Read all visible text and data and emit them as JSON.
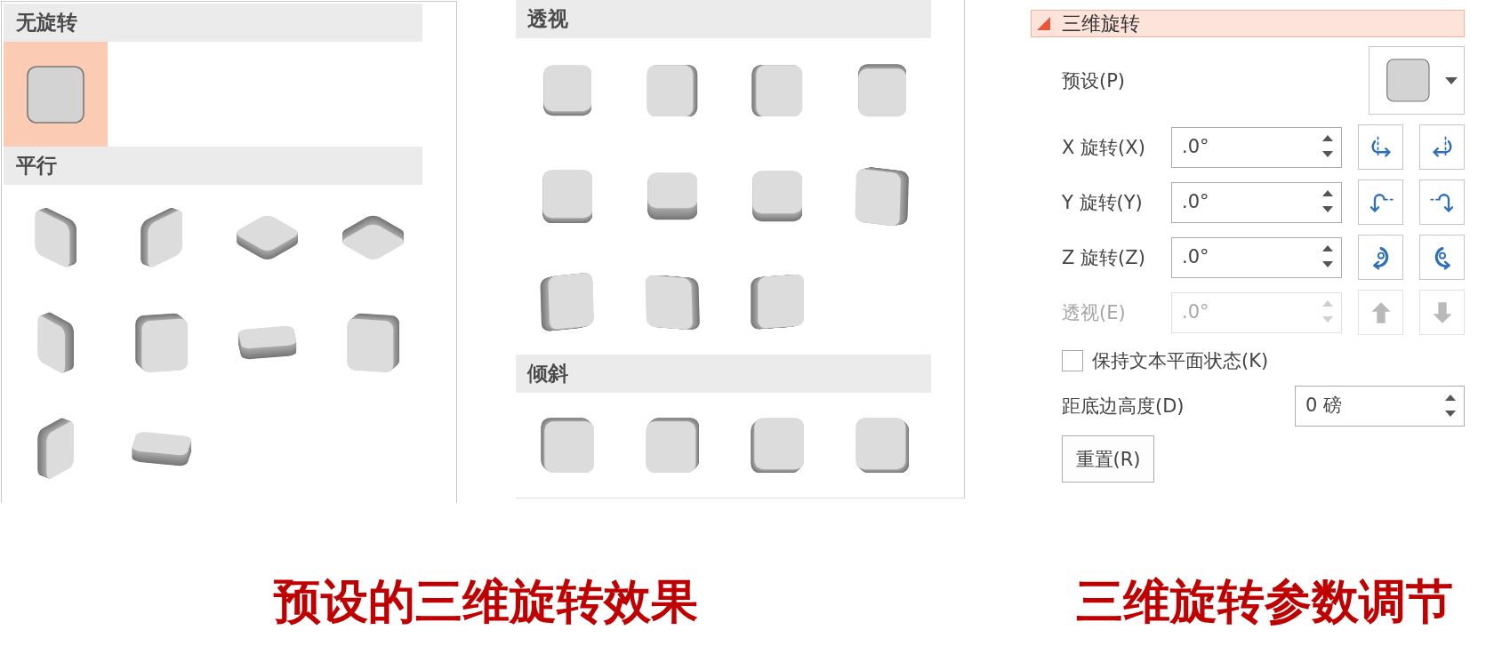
{
  "galleries": [
    {
      "sections": [
        {
          "title": "无旋转",
          "presets": [
            {
              "kind": "front",
              "selected": true
            }
          ]
        },
        {
          "title": "平行",
          "presets": [
            {
              "kind": "iso-right",
              "selected": false
            },
            {
              "kind": "iso-left",
              "selected": false
            },
            {
              "kind": "iso-top",
              "selected": false
            },
            {
              "kind": "iso-under",
              "selected": false
            },
            {
              "kind": "narrow-right",
              "selected": false
            },
            {
              "kind": "square-left",
              "selected": false
            },
            {
              "kind": "slab",
              "selected": false
            },
            {
              "kind": "square-right",
              "selected": false
            },
            {
              "kind": "narrow-left",
              "selected": false
            },
            {
              "kind": "slab-low",
              "selected": false
            }
          ]
        }
      ]
    },
    {
      "sections": [
        {
          "title": "透视",
          "presets": [
            {
              "kind": "bottom-thin",
              "selected": false
            },
            {
              "kind": "right-thin",
              "selected": false
            },
            {
              "kind": "left-thin",
              "selected": false
            },
            {
              "kind": "top-thin",
              "selected": false
            },
            {
              "kind": "bottom-mid",
              "selected": false
            },
            {
              "kind": "bottom-thick",
              "selected": false
            },
            {
              "kind": "bottom-band",
              "selected": false
            },
            {
              "kind": "right-tilt",
              "selected": false
            },
            {
              "kind": "left-tilt",
              "selected": false
            },
            {
              "kind": "right-lean",
              "selected": false
            },
            {
              "kind": "left-lean",
              "selected": false
            }
          ]
        },
        {
          "title": "倾斜",
          "presets": [
            {
              "kind": "top-left",
              "selected": false
            },
            {
              "kind": "top-right",
              "selected": false
            },
            {
              "kind": "bottom-left",
              "selected": false
            },
            {
              "kind": "bottom-right",
              "selected": false
            }
          ]
        }
      ]
    }
  ],
  "rotation_panel": {
    "header": {
      "title": "三维旋转",
      "expanded": true
    },
    "preset": {
      "label": "预设(P)"
    },
    "rotations": [
      {
        "kind": "x",
        "label": "X 旋转(X)",
        "value": ".0°",
        "disabled": false
      },
      {
        "kind": "y",
        "label": "Y 旋转(Y)",
        "value": ".0°",
        "disabled": false
      },
      {
        "kind": "z",
        "label": "Z 旋转(Z)",
        "value": ".0°",
        "disabled": false
      },
      {
        "kind": "perspective",
        "label": "透视(E)",
        "value": ".0°",
        "disabled": true
      }
    ],
    "keep_text_flat": {
      "label": "保持文本平面状态(K)",
      "checked": false
    },
    "distance_from_ground": {
      "label": "距底边高度(D)",
      "value": "0 磅"
    },
    "reset_button": {
      "label": "重置(R)"
    }
  },
  "captions": [
    "预设的三维旋转效果",
    "三维旋转参数调节"
  ]
}
